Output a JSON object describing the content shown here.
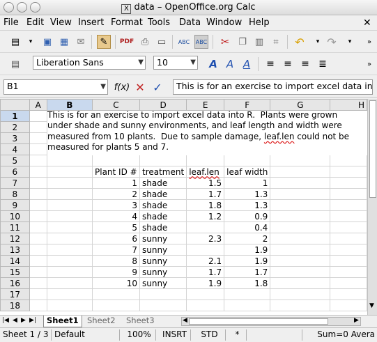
{
  "window": {
    "title": "data – OpenOffice.org Calc"
  },
  "menu": [
    "File",
    "Edit",
    "View",
    "Insert",
    "Format",
    "Tools",
    "Data",
    "Window",
    "Help"
  ],
  "font": {
    "name": "Liberation Sans",
    "size": "10"
  },
  "formula": {
    "cell_ref": "B1",
    "content": "This is for an exercise to import excel data int"
  },
  "columns": [
    "A",
    "B",
    "C",
    "D",
    "E",
    "F",
    "G",
    "H"
  ],
  "rows": [
    "1",
    "2",
    "3",
    "4",
    "5",
    "6",
    "7",
    "8",
    "9",
    "10",
    "11",
    "12",
    "13",
    "14",
    "15",
    "16",
    "17",
    "18"
  ],
  "note_lines": [
    "This is for an exercise to import excel data into R.  Plants were grown",
    "under shade and sunny environments, and leaf length and width were",
    "measured from 10 plants.  Due to sample damage, ",
    "leaf.len",
    " could not be",
    "measured for plants 5 and 7."
  ],
  "table": {
    "headers": [
      "Plant ID #",
      "treatment",
      "leaf.len",
      "leaf width"
    ],
    "rows": [
      [
        "1",
        "shade",
        "1.5",
        "1"
      ],
      [
        "2",
        "shade",
        "1.7",
        "1.3"
      ],
      [
        "3",
        "shade",
        "1.8",
        "1.3"
      ],
      [
        "4",
        "shade",
        "1.2",
        "0.9"
      ],
      [
        "5",
        "shade",
        "",
        "0.4"
      ],
      [
        "6",
        "sunny",
        "2.3",
        "2"
      ],
      [
        "7",
        "sunny",
        "",
        "1.9"
      ],
      [
        "8",
        "sunny",
        "2.1",
        "1.9"
      ],
      [
        "9",
        "sunny",
        "1.7",
        "1.7"
      ],
      [
        "10",
        "sunny",
        "1.9",
        "1.8"
      ]
    ]
  },
  "sheets": [
    "Sheet1",
    "Sheet2",
    "Sheet3"
  ],
  "status": {
    "sheet": "Sheet 1 / 3",
    "style": "Default",
    "zoom": "100%",
    "mode": "INSRT",
    "selection": "STD",
    "modified": "*",
    "sum": "Sum=0 Avera"
  }
}
